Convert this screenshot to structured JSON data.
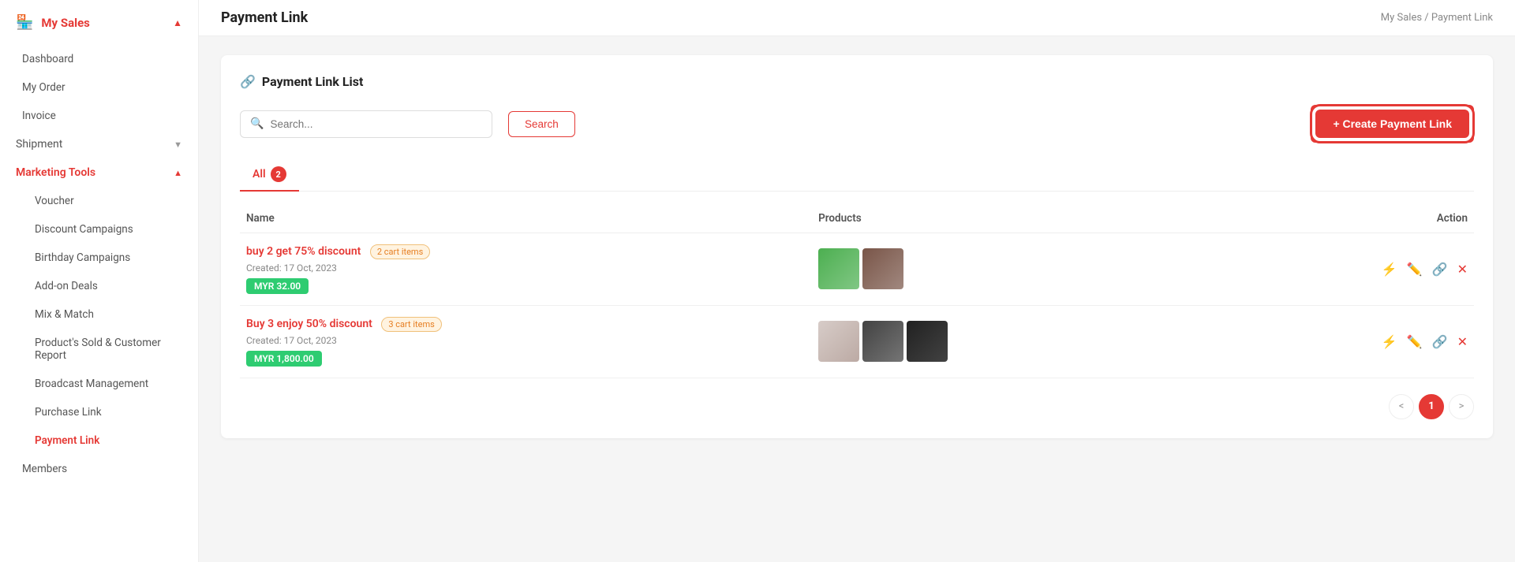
{
  "sidebar": {
    "brand": "My Sales",
    "items": [
      {
        "id": "dashboard",
        "label": "Dashboard",
        "active": false
      },
      {
        "id": "my-order",
        "label": "My Order",
        "active": false
      },
      {
        "id": "invoice",
        "label": "Invoice",
        "active": false
      },
      {
        "id": "shipment",
        "label": "Shipment",
        "active": false,
        "expandable": true
      },
      {
        "id": "marketing-tools",
        "label": "Marketing Tools",
        "active": false,
        "expanded": true
      },
      {
        "id": "voucher",
        "label": "Voucher",
        "active": false,
        "sub": true
      },
      {
        "id": "discount-campaigns",
        "label": "Discount Campaigns",
        "active": false,
        "sub": true
      },
      {
        "id": "birthday-campaigns",
        "label": "Birthday Campaigns",
        "active": false,
        "sub": true
      },
      {
        "id": "add-on-deals",
        "label": "Add-on Deals",
        "active": false,
        "sub": true
      },
      {
        "id": "mix-match",
        "label": "Mix & Match",
        "active": false,
        "sub": true
      },
      {
        "id": "products-sold",
        "label": "Product's Sold & Customer Report",
        "active": false,
        "sub": true
      },
      {
        "id": "broadcast-management",
        "label": "Broadcast Management",
        "active": false,
        "sub": true
      },
      {
        "id": "purchase-link",
        "label": "Purchase Link",
        "active": false,
        "sub": true
      },
      {
        "id": "payment-link",
        "label": "Payment Link",
        "active": true,
        "sub": true
      },
      {
        "id": "members",
        "label": "Members",
        "active": false
      }
    ]
  },
  "page": {
    "title": "Payment Link",
    "breadcrumb": "My Sales / Payment Link"
  },
  "card": {
    "title": "Payment Link List",
    "icon": "🔗"
  },
  "search": {
    "placeholder": "Search...",
    "button_label": "Search"
  },
  "create_button": "+ Create Payment Link",
  "tabs": [
    {
      "id": "all",
      "label": "All",
      "badge": "2",
      "active": true
    }
  ],
  "table": {
    "columns": [
      "Name",
      "Products",
      "Action"
    ],
    "rows": [
      {
        "id": 1,
        "name": "buy 2 get 75% discount",
        "badge": "2 cart items",
        "created": "Created: 17 Oct, 2023",
        "price": "MYR 32.00",
        "images": [
          "green-herb",
          "dark-red-berries"
        ]
      },
      {
        "id": 2,
        "name": "Buy 3 enjoy 50% discount",
        "badge": "3 cart items",
        "created": "Created: 17 Oct, 2023",
        "price": "MYR 1,800.00",
        "images": [
          "suit-man",
          "dark-jacket",
          "black-shoes"
        ]
      }
    ]
  },
  "pagination": {
    "current": "1",
    "prev": "<",
    "next": ">"
  }
}
